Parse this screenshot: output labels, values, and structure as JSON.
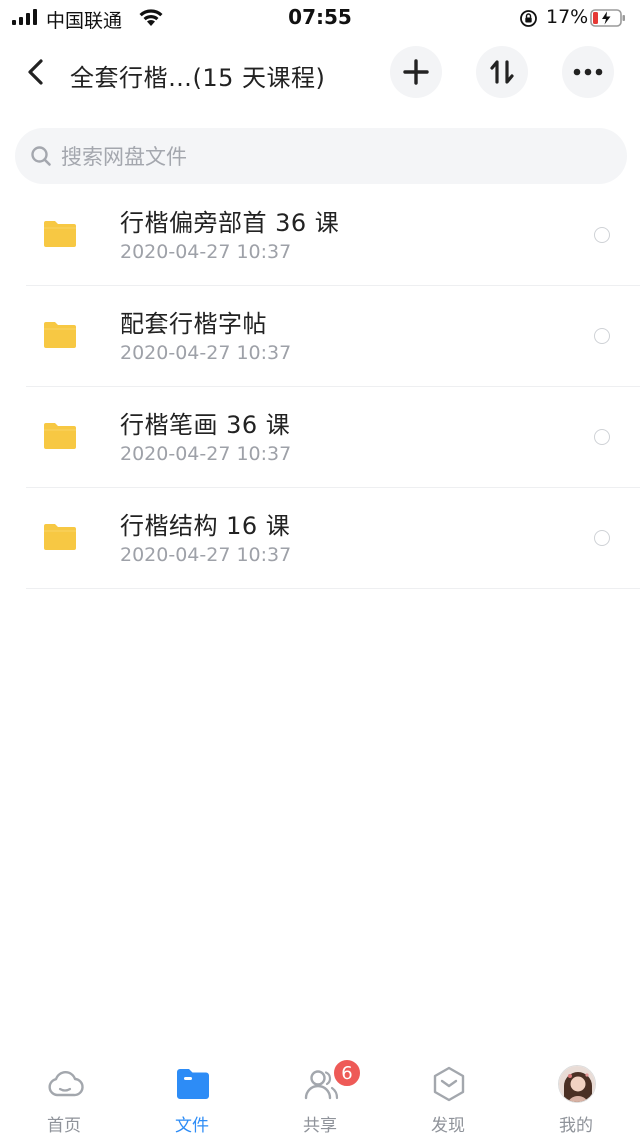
{
  "status_bar": {
    "carrier": "中国联通",
    "time": "07:55",
    "battery_percent": "17%"
  },
  "header": {
    "title": "全套行楷…(15 天课程)"
  },
  "search": {
    "placeholder": "搜索网盘文件"
  },
  "files": [
    {
      "name": "行楷偏旁部首 36 课",
      "date": "2020-04-27 10:37",
      "icon": "folder-icon"
    },
    {
      "name": "配套行楷字帖",
      "date": "2020-04-27 10:37",
      "icon": "folder-icon"
    },
    {
      "name": "行楷笔画 36 课",
      "date": "2020-04-27 10:37",
      "icon": "folder-icon"
    },
    {
      "name": "行楷结构 16 课",
      "date": "2020-04-27 10:37",
      "icon": "folder-icon"
    }
  ],
  "bottom_nav": {
    "home": "首页",
    "files": "文件",
    "share": "共享",
    "share_badge": "6",
    "discover": "发现",
    "mine": "我的",
    "active": "files"
  },
  "colors": {
    "accent": "#2d8cf6",
    "folder": "#f7c843",
    "badge": "#ee5a57",
    "inactive": "#8f939a"
  }
}
